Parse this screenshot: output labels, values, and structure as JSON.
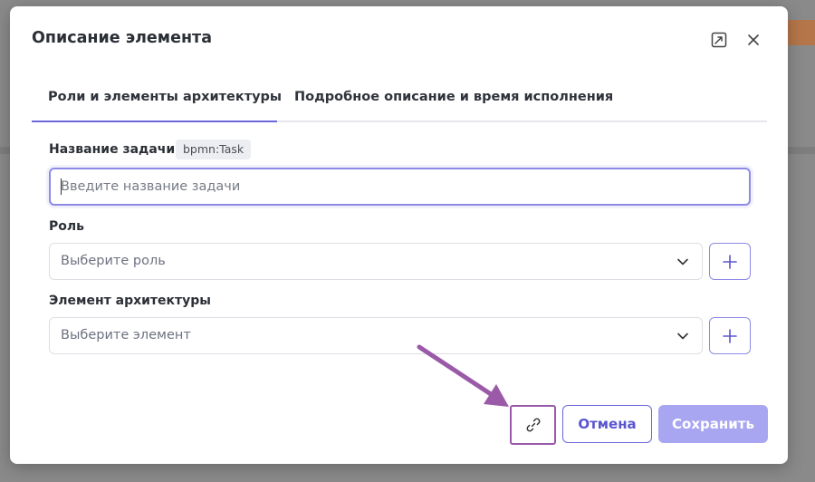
{
  "modal": {
    "title": "Описание элемента",
    "expand_icon": "expand-icon",
    "close_icon": "close-icon"
  },
  "tabs": [
    {
      "label": "Роли и элементы архитектуры",
      "active": true
    },
    {
      "label": "Подробное описание и время исполнения",
      "active": false
    }
  ],
  "task_name": {
    "label": "Название задачи",
    "tag": "bpmn:Task",
    "value": "",
    "placeholder": "Введите название задачи"
  },
  "role": {
    "label": "Роль",
    "placeholder": "Выберите роль"
  },
  "architecture_element": {
    "label": "Элемент архитектуры",
    "placeholder": "Выберите элемент"
  },
  "footer": {
    "link_icon": "link-icon",
    "cancel_label": "Отмена",
    "save_label": "Сохранить"
  },
  "colors": {
    "accent": "#6c68d8",
    "save_disabled": "#a9a6f1",
    "annotation_arrow": "#9a5aa8"
  }
}
